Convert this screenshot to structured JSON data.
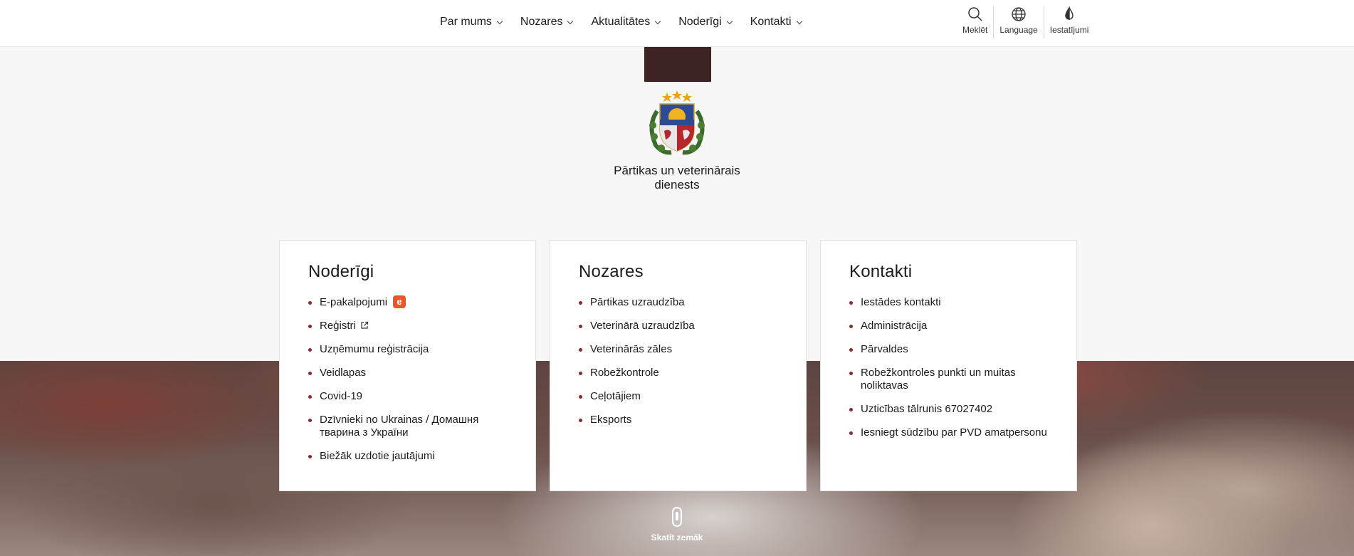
{
  "nav": {
    "items": [
      {
        "label": "Par mums"
      },
      {
        "label": "Nozares"
      },
      {
        "label": "Aktualitātes"
      },
      {
        "label": "Noderīgi"
      },
      {
        "label": "Kontakti"
      }
    ]
  },
  "tools": {
    "search": {
      "label": "Meklēt",
      "icon": "search-icon"
    },
    "language": {
      "label": "Language",
      "icon": "globe-icon"
    },
    "settings": {
      "label": "Iestatījumi",
      "icon": "drop-icon"
    }
  },
  "hero": {
    "org_name": "Pārtikas un veterinārais dienests",
    "block_color": "#3e2325"
  },
  "cards": {
    "noderigi": {
      "title": "Noderīgi",
      "items": [
        "E-pakalpojumi",
        "Reģistri",
        "Uzņēmumu reģistrācija",
        "Veidlapas",
        "Covid-19",
        "Dzīvnieki no Ukrainas / Домашня тварина з України",
        "Biežāk uzdotie jautājumi"
      ],
      "e_badge": "e"
    },
    "nozares": {
      "title": "Nozares",
      "items": [
        "Pārtikas uzraudzība",
        "Veterinārā uzraudzība",
        "Veterinārās zāles",
        "Robežkontrole",
        "Ceļotājiem",
        "Eksports"
      ]
    },
    "kontakti": {
      "title": "Kontakti",
      "items": [
        "Iestādes kontakti",
        "Administrācija",
        "Pārvaldes",
        "Robežkontroles punkti un muitas noliktavas",
        "Uzticības tālrunis 67027402",
        "Iesniegt sūdzību par PVD amatpersonu"
      ]
    }
  },
  "scroll_hint": {
    "label": "Skatīt zemāk"
  },
  "colors": {
    "accent": "#8a2a2b",
    "badge": "#e8562a"
  }
}
